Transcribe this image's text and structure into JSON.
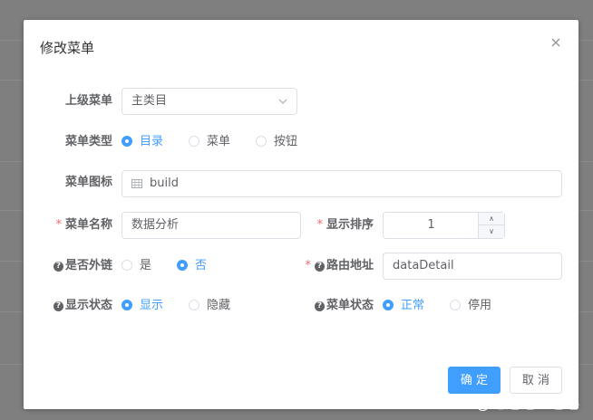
{
  "dialog": {
    "title": "修改菜单"
  },
  "form": {
    "parent_menu": {
      "label": "上级菜单",
      "value": "主类目"
    },
    "menu_type": {
      "label": "菜单类型",
      "options": [
        "目录",
        "菜单",
        "按钮"
      ],
      "selected": "目录"
    },
    "menu_icon": {
      "label": "菜单图标",
      "value": "build"
    },
    "menu_name": {
      "label": "菜单名称",
      "value": "数据分析",
      "required": "*"
    },
    "sort_order": {
      "label": "显示排序",
      "value": "1",
      "required": "*",
      "up": "∧",
      "down": "∨"
    },
    "is_external": {
      "label": "是否外链",
      "options": [
        "是",
        "否"
      ],
      "selected": "否"
    },
    "route_path": {
      "label": "路由地址",
      "value": "dataDetail",
      "required": "*"
    },
    "visibility": {
      "label": "显示状态",
      "options": [
        "显示",
        "隐藏"
      ],
      "selected": "显示"
    },
    "menu_status": {
      "label": "菜单状态",
      "options": [
        "正常",
        "停用"
      ],
      "selected": "正常"
    }
  },
  "footer": {
    "confirm_label": "确 定",
    "cancel_label": "取 消"
  },
  "watermark": "CSDN @吃泡泡吐皂皂",
  "colors": {
    "primary": "#409eff",
    "required": "#f56c6c",
    "overlay": "#7f7f7f"
  }
}
